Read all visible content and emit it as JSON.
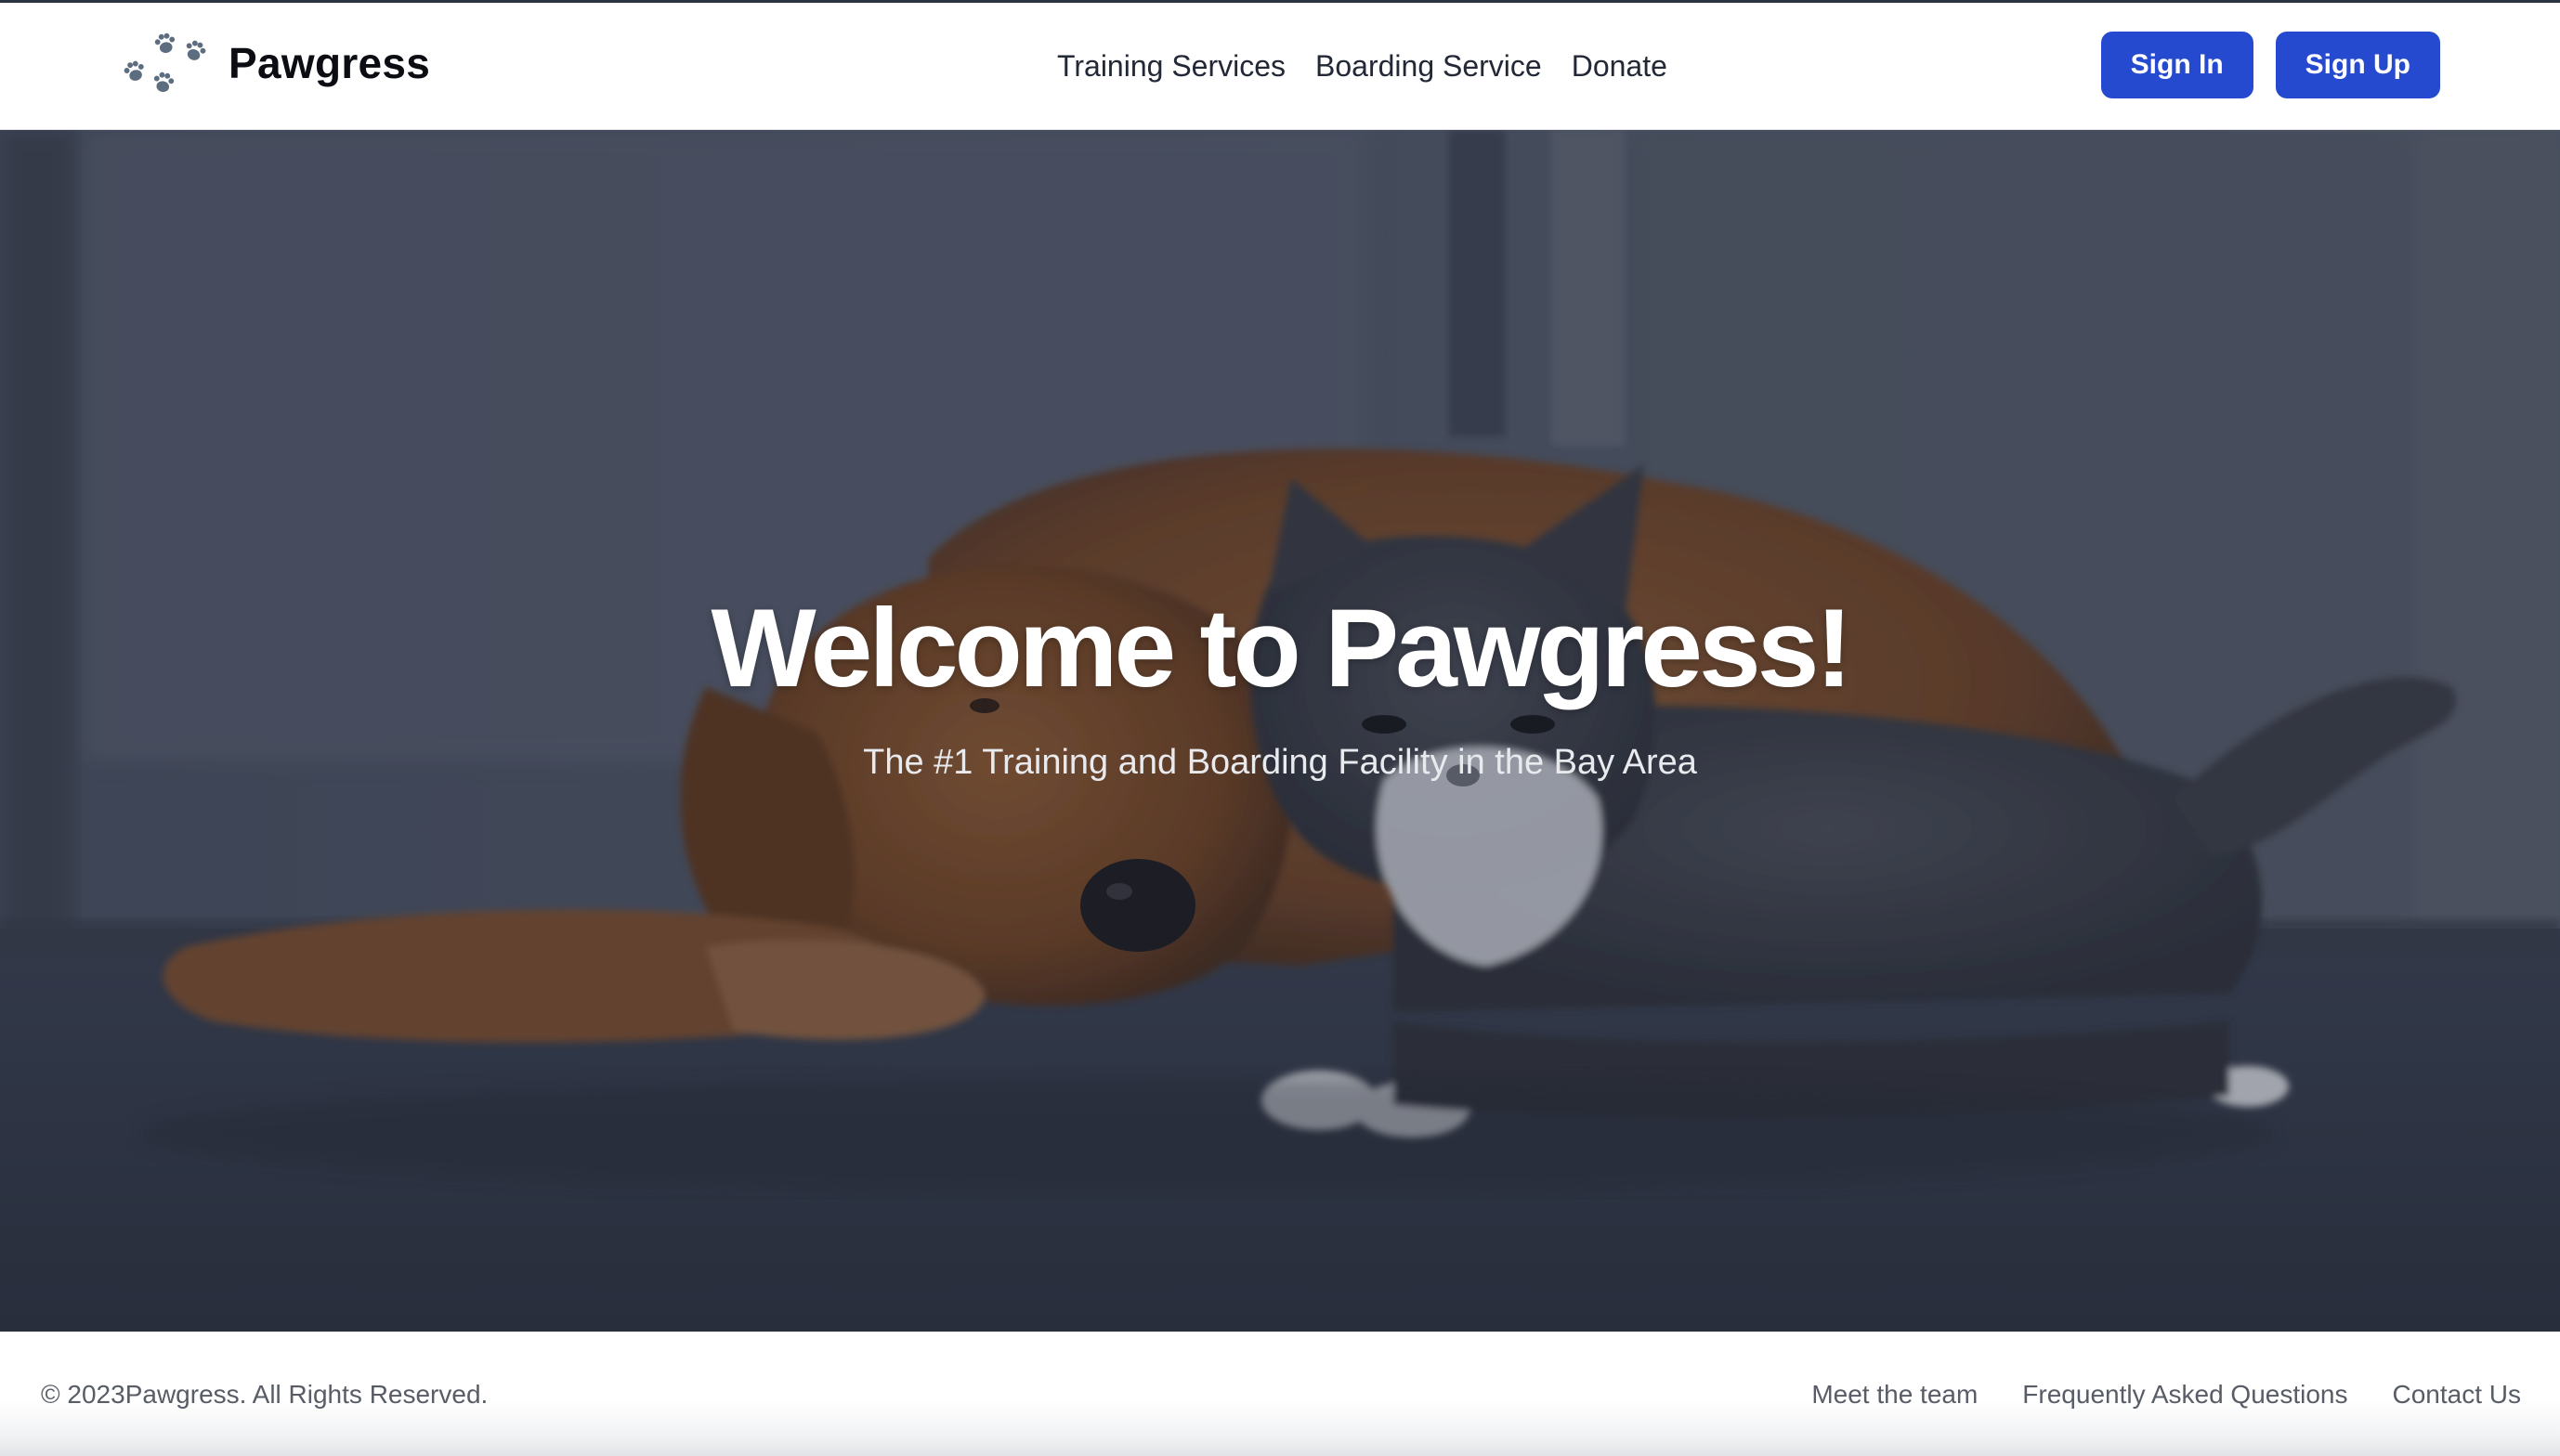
{
  "brand": {
    "name": "Pawgress",
    "logo_icon": "paw-prints-icon",
    "logo_color": "#5d6d80"
  },
  "nav": {
    "links": [
      "Training Services",
      "Boarding Service",
      "Donate"
    ]
  },
  "auth": {
    "sign_in_label": "Sign In",
    "sign_up_label": "Sign Up",
    "button_color": "#2549cf"
  },
  "hero": {
    "title": "Welcome to Pawgress!",
    "subtitle": "The #1 Training and Boarding Facility in the Bay Area",
    "background_image": "golden-retriever-and-gray-cat-lying-on-floor"
  },
  "footer": {
    "copyright": "© 2023Pawgress. All Rights Reserved.",
    "links": [
      "Meet the team",
      "Frequently Asked Questions",
      "Contact Us"
    ]
  }
}
